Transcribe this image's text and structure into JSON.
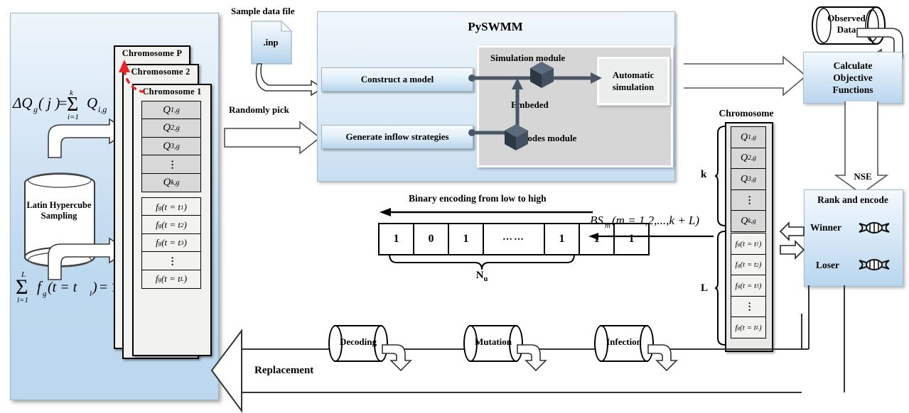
{
  "left_panel": {
    "formula_delta_q": "ΔQg(j) = Σ(i=1..k) Qi,g",
    "formula_sum_f": "Σ(l=1..L) fg(t=tl) = 1",
    "sampling_label": "Latin Hypercube Sampling",
    "chromosomes": [
      {
        "title": "Chromosome  P"
      },
      {
        "title": "Chromosome  2"
      },
      {
        "title": "Chromosome  1"
      }
    ],
    "genes_q": [
      "Q1,g",
      "Q2,g",
      "Q3,g",
      "⋮",
      "Qk,g"
    ],
    "genes_f": [
      "fg(t = t1)",
      "fg(t = t2)",
      "fg(t = t3)",
      "⋮",
      "fg(t = tL)"
    ]
  },
  "input": {
    "sample_file_label": "Sample data file",
    "file_icon_text": ".inp",
    "randomly_pick_label": "Randomly pick"
  },
  "pyswmm": {
    "title": "PySWMM",
    "construct_model": "Construct  a model",
    "generate_inflow": "Generate inflow  strategies",
    "simulation_module": "Simulation  module",
    "nodes_module": "Nodes module",
    "embeded_label": "Embeded",
    "automatic_simulation": "Automatic simulation"
  },
  "objective": {
    "observed_data": "Observed Data",
    "calculate_objective": "Calculate Objective Functions",
    "nse_label": "NSE"
  },
  "rank": {
    "title": "Rank and  encode",
    "winner": "Winner",
    "loser": "Loser",
    "dna_icon": "dna-icon"
  },
  "encoding": {
    "heading": "Binary encoding from  low to high",
    "bits": [
      "1",
      "0",
      "1",
      "⋯⋯",
      "1",
      "1",
      "1"
    ],
    "brace_label": "Nu",
    "bs_formula": "BSm (m = 1,2,...,k + L)"
  },
  "chromosome_right": {
    "title": "Chromosome",
    "k_label": "k",
    "l_label": "L",
    "genes_q": [
      "Q1,g",
      "Q2,g",
      "Q3,g",
      "⋮",
      "Qk,g"
    ],
    "genes_f": [
      "fg(t = t1)",
      "fg(t = t2)",
      "fg(t = t3)",
      "⋮",
      "fg(t = tL)"
    ]
  },
  "operators": {
    "decoding": "Decoding",
    "mutation": "Mutation",
    "infection": "Infection",
    "replacement": "Replacement"
  },
  "colors": {
    "panel_blue_light": "#eef5fb",
    "panel_blue_dark": "#bcd7ee",
    "gray_panel": "#d6d6d6",
    "gene_gray": "#d8d8d8",
    "arrow_dark": "#4a5666",
    "red_dashed": "#e8262a"
  }
}
